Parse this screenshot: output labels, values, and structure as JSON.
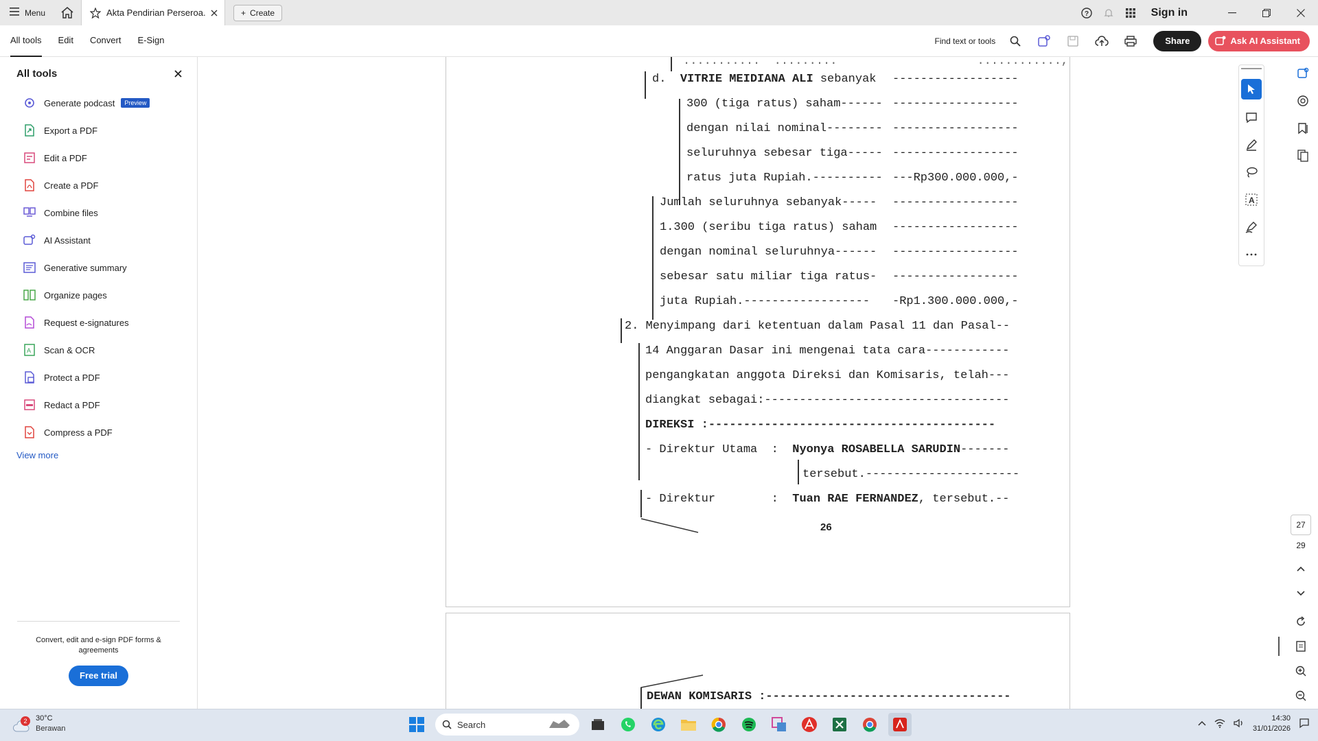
{
  "titlebar": {
    "menu_label": "Menu",
    "doc_tab_title": "Akta Pendirian Perseroa...",
    "create_label": "Create",
    "signin_label": "Sign in"
  },
  "toolbar": {
    "tabs": [
      "All tools",
      "Edit",
      "Convert",
      "E-Sign"
    ],
    "find_label": "Find text or tools",
    "share_label": "Share",
    "ask_ai_label": "Ask AI Assistant"
  },
  "left_panel": {
    "title": "All tools",
    "items": [
      {
        "label": "Generate podcast",
        "badge": "Preview",
        "icon": "podcast-icon",
        "color": "#5b5bd6"
      },
      {
        "label": "Export a PDF",
        "icon": "export-pdf-icon",
        "color": "#2e9e6a"
      },
      {
        "label": "Edit a PDF",
        "icon": "edit-pdf-icon",
        "color": "#d94a7b"
      },
      {
        "label": "Create a PDF",
        "icon": "create-pdf-icon",
        "color": "#e0443e"
      },
      {
        "label": "Combine files",
        "icon": "combine-icon",
        "color": "#6b5bd6"
      },
      {
        "label": "AI Assistant",
        "icon": "ai-assistant-icon",
        "color": "#5b5bd6"
      },
      {
        "label": "Generative summary",
        "icon": "summary-icon",
        "color": "#5b5bd6"
      },
      {
        "label": "Organize pages",
        "icon": "organize-icon",
        "color": "#4aa84a"
      },
      {
        "label": "Request e-signatures",
        "icon": "esign-icon",
        "color": "#b44ad6"
      },
      {
        "label": "Scan & OCR",
        "icon": "scan-icon",
        "color": "#3aa55a"
      },
      {
        "label": "Protect a PDF",
        "icon": "protect-icon",
        "color": "#5b5bd6"
      },
      {
        "label": "Redact a PDF",
        "icon": "redact-icon",
        "color": "#d94a7b"
      },
      {
        "label": "Compress a PDF",
        "icon": "compress-icon",
        "color": "#e0443e"
      }
    ],
    "view_more": "View more",
    "footer_text": "Convert, edit and e-sign PDF forms & agreements",
    "free_trial_label": "Free trial"
  },
  "document": {
    "top_partial": "...........  .........                    ............,",
    "lines_d": [
      {
        "left": "d.  ",
        "bold": "VITRIE MEIDIANA ALI",
        "rest": " sebanyak",
        "right": "------------------"
      },
      {
        "left": "300 (tiga ratus) saham------",
        "right": "------------------"
      },
      {
        "left": "dengan nilai nominal--------",
        "right": "------------------"
      },
      {
        "left": "seluruhnya sebesar tiga-----",
        "right": "------------------"
      },
      {
        "left": "ratus juta Rupiah.----------",
        "right": "---Rp300.000.000,-"
      }
    ],
    "lines_total": [
      {
        "left": "Jumlah seluruhnya sebanyak-----",
        "right": "------------------"
      },
      {
        "left": "1.300 (seribu tiga ratus) saham",
        "right": "------------------"
      },
      {
        "left": "dengan nominal seluruhnya------",
        "right": "------------------"
      },
      {
        "left": "sebesar satu miliar tiga ratus-",
        "right": "------------------"
      },
      {
        "left": "juta Rupiah.------------------",
        "right": "-Rp1.300.000.000,-"
      }
    ],
    "para2_line1": "2. Menyimpang dari ketentuan dalam Pasal 11 dan Pasal--",
    "para2_line2": "14 Anggaran Dasar ini mengenai tata cara------------",
    "para2_line3": "pengangkatan anggota Direksi dan Komisaris, telah---",
    "para2_line4": "diangkat sebagai:-----------------------------------",
    "direksi": "DIREKSI :-----------------------------------------",
    "dir_utama_label": "- Direktur Utama  :  ",
    "dir_utama_name": "Nyonya ROSABELLA SARUDIN",
    "dir_utama_dash": "-------",
    "dir_utama_cont": "tersebut.----------------------",
    "direktur_label": "- Direktur        :  ",
    "direktur_name": "Tuan RAE FERNANDEZ",
    "direktur_rest": ", tersebut.--",
    "page_number": "26",
    "dewan": "DEWAN KOMISARIS :-----------------------------------"
  },
  "navigation": {
    "current_page": "27",
    "total_pages": "29"
  },
  "taskbar": {
    "notification_count": "2",
    "temperature": "30°C",
    "weather_desc": "Berawan",
    "search_placeholder": "Search",
    "time": "14:30",
    "date": "31/01/2026"
  }
}
